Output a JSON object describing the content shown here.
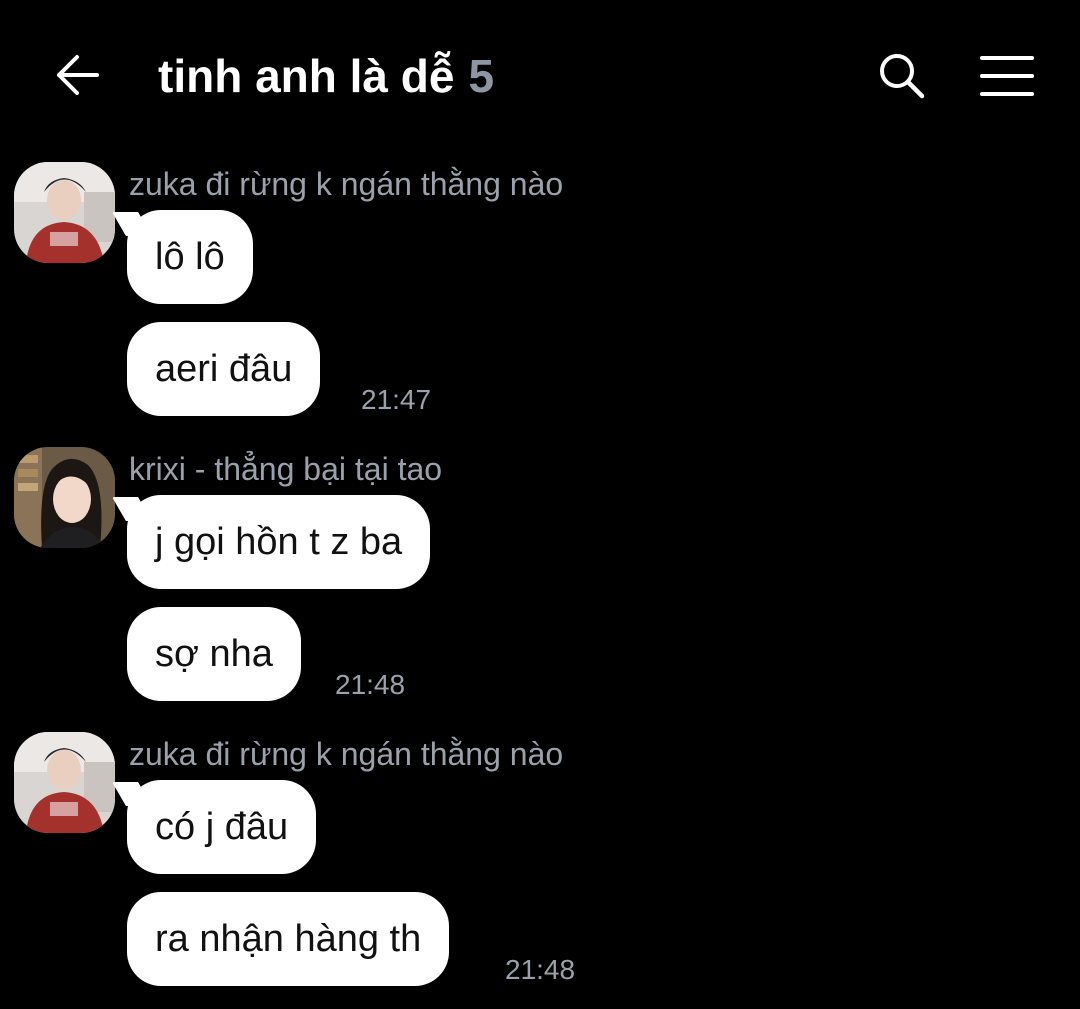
{
  "header": {
    "back_icon": "arrow-left-icon",
    "title": "tinh anh là dễ",
    "member_count": "5",
    "search_icon": "search-icon",
    "menu_icon": "hamburger-menu-icon"
  },
  "messages": [
    {
      "sender": "zuka đi rừng k ngán thằng nào",
      "avatar": "avatar-zuka",
      "bubbles": [
        "lô lô",
        "aeri đâu"
      ],
      "time": "21:47"
    },
    {
      "sender": "krixi - thẳng bại tại tao",
      "avatar": "avatar-krixi",
      "bubbles": [
        "j gọi hồn t z ba",
        "sợ nha"
      ],
      "time": "21:48"
    },
    {
      "sender": "zuka đi rừng k ngán thằng nào",
      "avatar": "avatar-zuka",
      "bubbles": [
        "có j đâu",
        "ra nhận hàng th"
      ],
      "time": "21:48"
    }
  ],
  "colors": {
    "background": "#000000",
    "bubble": "#ffffff",
    "muted_text": "#9aa1ab",
    "count_text": "#8d97a4"
  }
}
